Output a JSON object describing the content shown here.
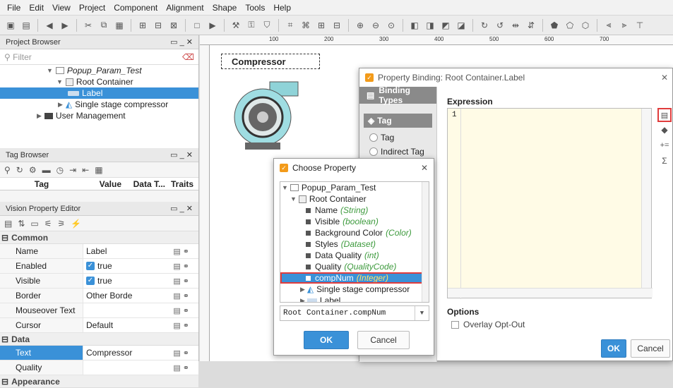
{
  "menubar": [
    "File",
    "Edit",
    "View",
    "Project",
    "Component",
    "Alignment",
    "Shape",
    "Tools",
    "Help"
  ],
  "project_browser": {
    "title": "Project Browser",
    "filter_placeholder": "Filter",
    "items": [
      {
        "label": "Popup_Param_Test",
        "italic": true
      },
      {
        "label": "Root Container"
      },
      {
        "label": "Label",
        "selected": true
      },
      {
        "label": "Single stage compressor"
      },
      {
        "label": "User Management"
      }
    ]
  },
  "tag_browser": {
    "title": "Tag Browser",
    "columns": [
      "Tag",
      "Value",
      "Data T...",
      "Traits"
    ]
  },
  "property_editor": {
    "title": "Vision Property Editor",
    "common": "Common",
    "data": "Data",
    "appearance": "Appearance",
    "rows": [
      {
        "name": "Name",
        "value": "Label"
      },
      {
        "name": "Enabled",
        "value": "true",
        "checked": true
      },
      {
        "name": "Visible",
        "value": "true",
        "checked": true
      },
      {
        "name": "Border",
        "value": "Other Borde"
      },
      {
        "name": "Mouseover Text",
        "value": ""
      },
      {
        "name": "Cursor",
        "value": "Default"
      }
    ],
    "data_rows": [
      {
        "name": "Text",
        "value": "Compressor"
      },
      {
        "name": "Quality",
        "value": ""
      }
    ]
  },
  "ruler_marks": [
    "100",
    "200",
    "300",
    "400",
    "500",
    "600",
    "700"
  ],
  "canvas": {
    "label": "Compressor"
  },
  "binding_dialog": {
    "title": "Property Binding: Root Container.Label",
    "binding_types": "Binding Types",
    "tag_section": "Tag",
    "options": [
      "Tag",
      "Indirect Tag"
    ],
    "expression_label": "Expression",
    "line_number": "1",
    "options_label": "Options",
    "overlay": "Overlay Opt-Out",
    "ok": "OK",
    "cancel": "Cancel"
  },
  "choose_dialog": {
    "title": "Choose Property",
    "root": "Popup_Param_Test",
    "container": "Root Container",
    "props": [
      {
        "name": "Name",
        "type": "(String)"
      },
      {
        "name": "Visible",
        "type": "(boolean)"
      },
      {
        "name": "Background Color",
        "type": "(Color)"
      },
      {
        "name": "Styles",
        "type": "(Dataset)"
      },
      {
        "name": "Data Quality",
        "type": "(int)"
      },
      {
        "name": "Quality",
        "type": "(QualityCode)"
      },
      {
        "name": "compNum",
        "type": "(Integer)",
        "selected": true
      }
    ],
    "children": [
      "Single stage compressor",
      "Label"
    ],
    "path": "Root Container.compNum",
    "ok": "OK",
    "cancel": "Cancel"
  },
  "colors": {
    "accent": "#3a91d8",
    "highlight_border": "#e03c3c",
    "type_green": "#3d9a3d"
  }
}
